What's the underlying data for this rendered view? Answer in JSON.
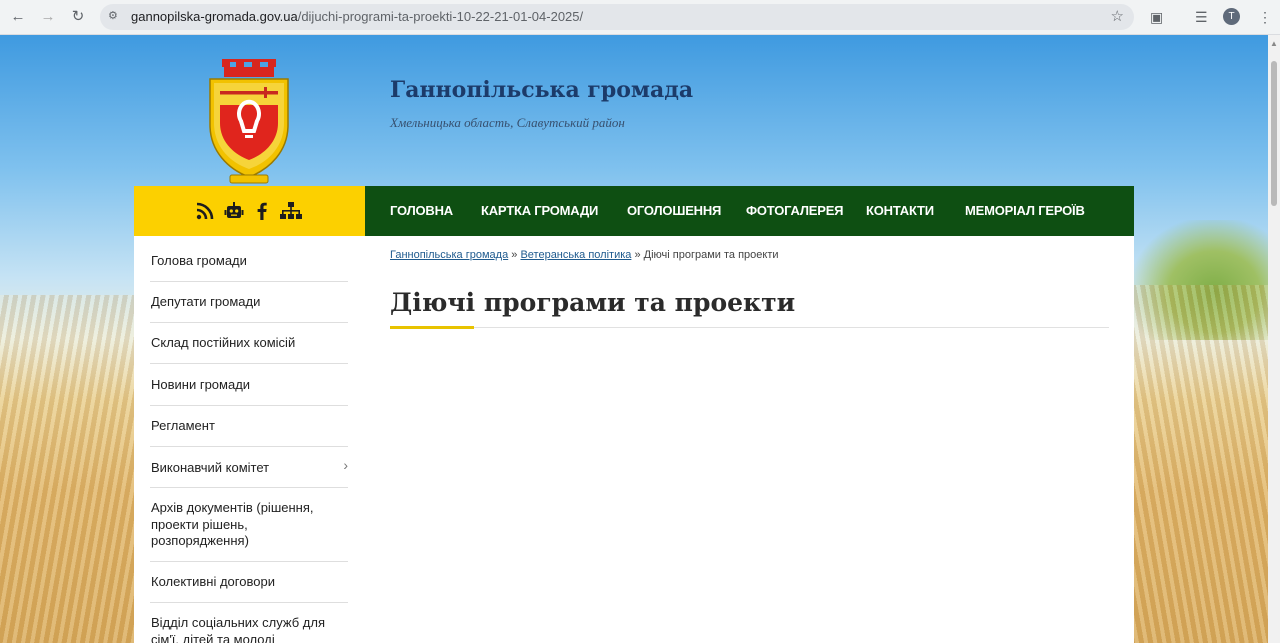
{
  "browser": {
    "url_host": "gannopilska-gromada.gov.ua",
    "url_path": "/dijuchi-programi-ta-proekti-10-22-21-01-04-2025/",
    "avatar_letter": "T"
  },
  "header": {
    "title": "Ганнопільська громада",
    "subtitle": "Хмельницька область, Славутський район"
  },
  "icon_bar": {
    "icons": [
      "rss-icon",
      "robot-icon",
      "facebook-icon",
      "sitemap-icon"
    ],
    "color": "#fcd000"
  },
  "menu": {
    "color": "#0e4f12",
    "items": [
      {
        "label": "ГОЛОВНА"
      },
      {
        "label": "КАРТКА ГРОМАДИ"
      },
      {
        "label": "ОГОЛОШЕННЯ"
      },
      {
        "label": "ФОТОГАЛЕРЕЯ"
      },
      {
        "label": "КОНТАКТИ"
      },
      {
        "label": "МЕМОРІАЛ ГЕРОЇВ"
      }
    ]
  },
  "sidebar": {
    "items": [
      {
        "label": "Голова громади"
      },
      {
        "label": "Депутати громади"
      },
      {
        "label": "Склад постійних комісій"
      },
      {
        "label": "Новини громади"
      },
      {
        "label": "Регламент"
      },
      {
        "label": "Виконавчий комітет",
        "has_submenu": true
      },
      {
        "label": "Архів документів (рішення, проекти рішень, розпорядження)"
      },
      {
        "label": "Колективні договори"
      },
      {
        "label": "Відділ соціальних служб для сім'ї, дітей та молоді"
      }
    ]
  },
  "breadcrumb": {
    "items": [
      {
        "label": "Ганнопільська громада",
        "link": true
      },
      {
        "label": "Ветеранська політика",
        "link": true
      },
      {
        "label": "Діючі програми та проекти",
        "link": false
      }
    ],
    "separator": "»"
  },
  "page": {
    "title": "Діючі програми та проекти"
  }
}
